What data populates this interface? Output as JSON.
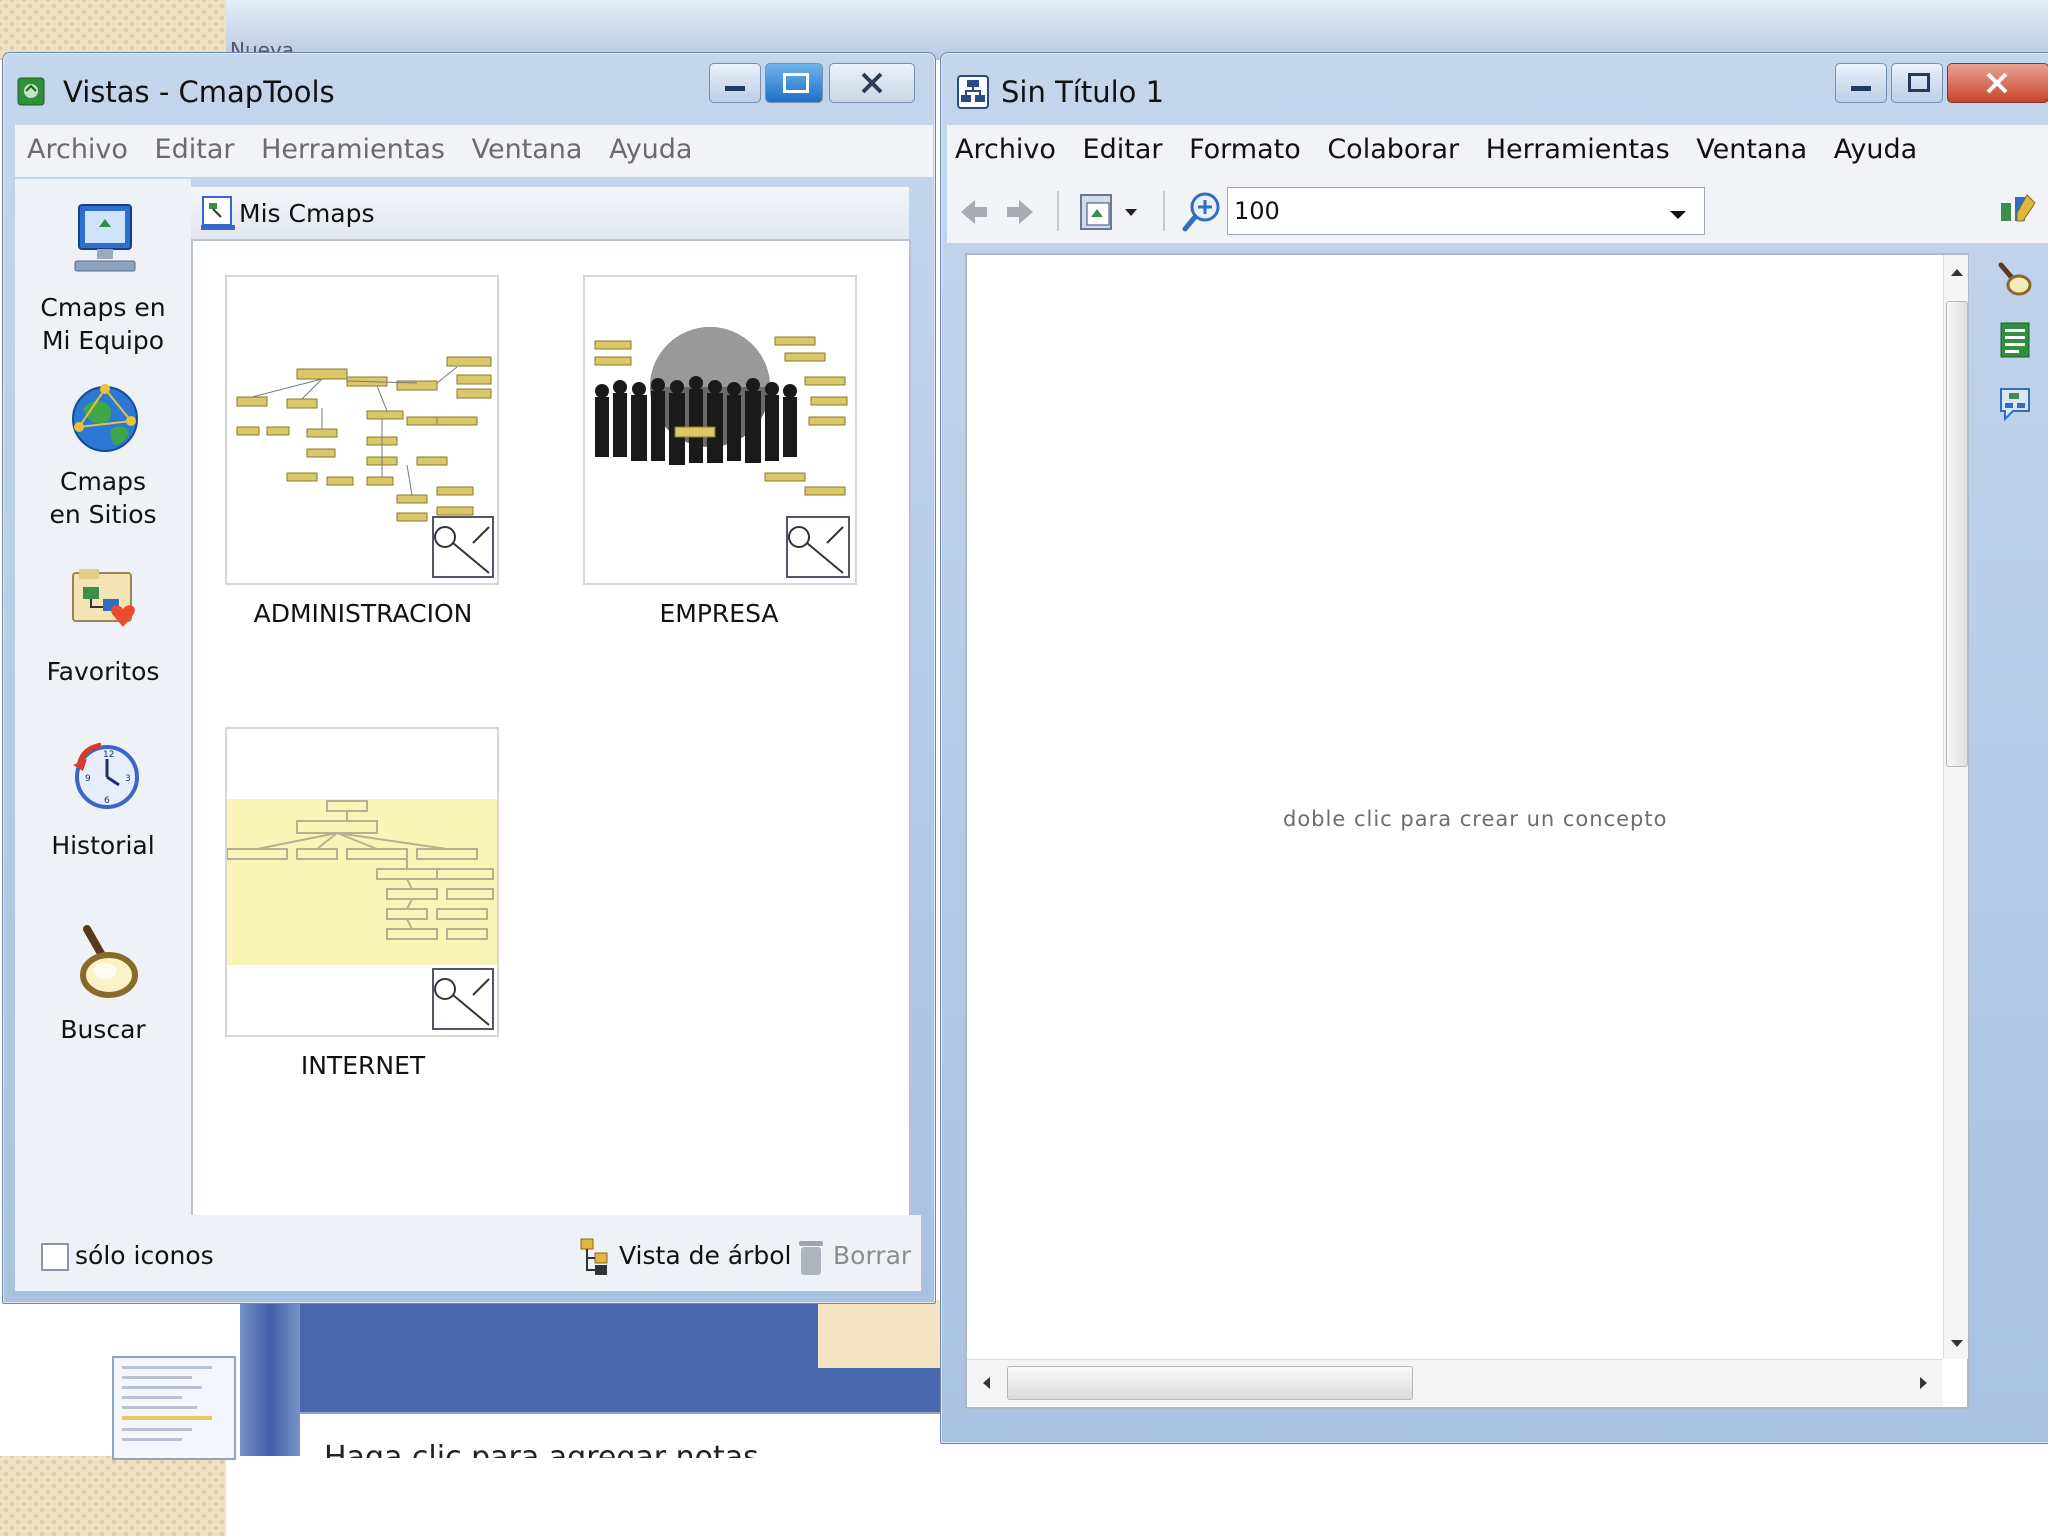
{
  "left_window": {
    "title": "Vistas - CmapTools",
    "menu": [
      "Archivo",
      "Editar",
      "Herramientas",
      "Ventana",
      "Ayuda"
    ],
    "panel_title": "Mis Cmaps",
    "sidebar": [
      {
        "label": "Cmaps en\nMi Equipo",
        "icon": "computer-icon"
      },
      {
        "label": "Cmaps\nen Sitios",
        "icon": "globe-network-icon"
      },
      {
        "label": "Favoritos",
        "icon": "favorites-icon"
      },
      {
        "label": "Historial",
        "icon": "history-clock-icon"
      },
      {
        "label": "Buscar",
        "icon": "magnifier-icon"
      }
    ],
    "cmaps": [
      {
        "name": "ADMINISTRACION"
      },
      {
        "name": "EMPRESA"
      },
      {
        "name": "INTERNET"
      }
    ],
    "footer": {
      "checkbox_label": "sólo iconos",
      "tree_view_label": "Vista de árbol",
      "delete_label": "Borrar"
    }
  },
  "right_window": {
    "title": "Sin Título 1",
    "menu": [
      "Archivo",
      "Editar",
      "Formato",
      "Colaborar",
      "Herramientas",
      "Ventana",
      "Ayuda"
    ],
    "zoom_value": "100",
    "canvas_hint": "doble clic para crear un concepto"
  },
  "background": {
    "notes_text": "Haga clic para agregar notas",
    "top_fragment": "Nueva"
  }
}
